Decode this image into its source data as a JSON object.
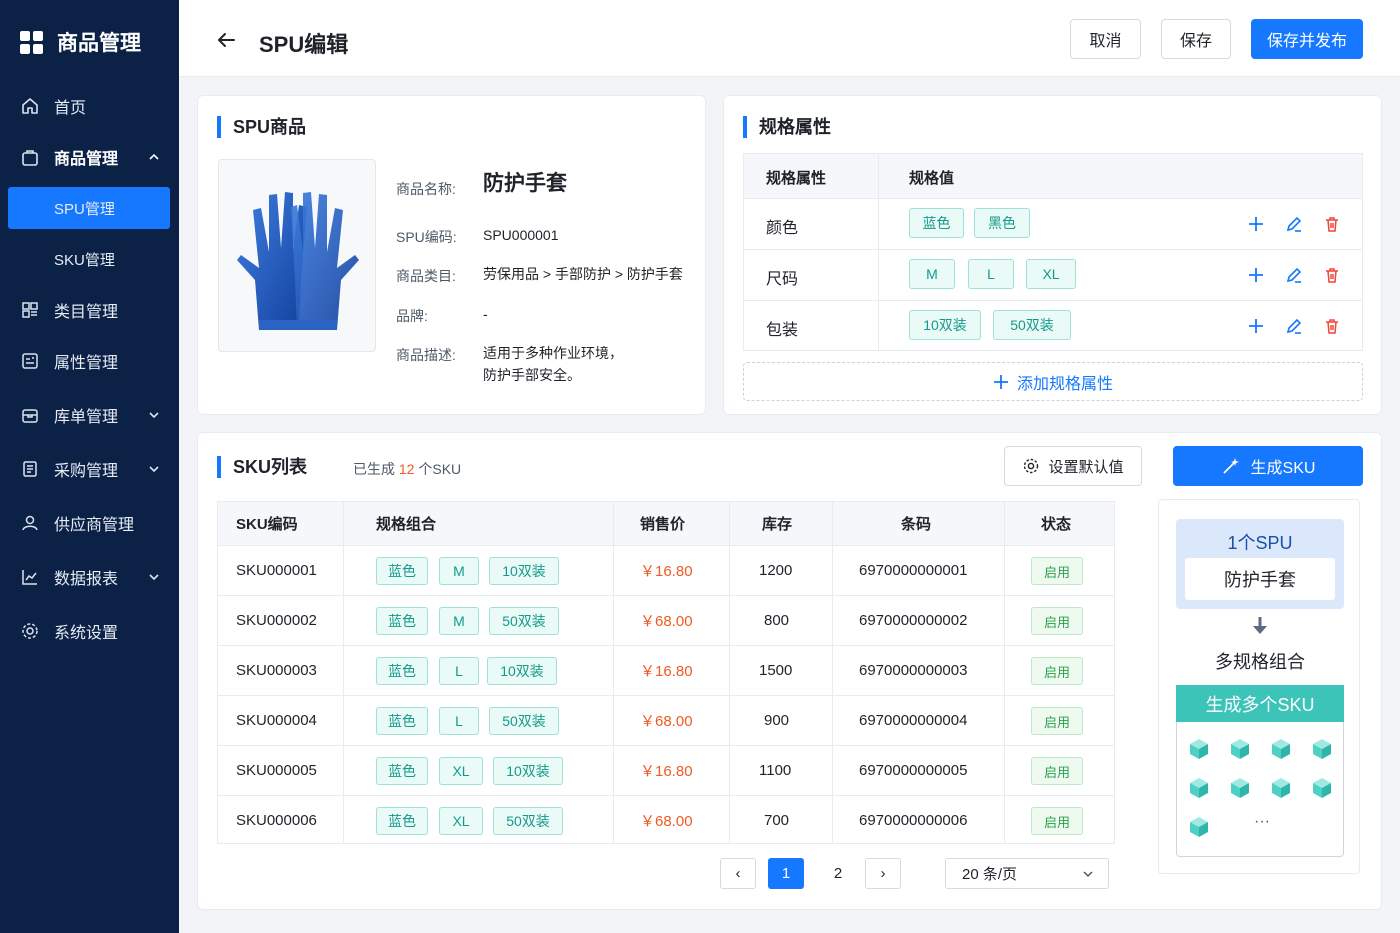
{
  "app": {
    "title": "商品管理"
  },
  "sidebar": {
    "items": [
      {
        "label": "首页",
        "icon": "home-icon"
      },
      {
        "label": "商品管理",
        "icon": "bag-icon"
      },
      {
        "label": "SPU管理"
      },
      {
        "label": "SKU管理"
      },
      {
        "label": "类目管理",
        "icon": "category-icon"
      },
      {
        "label": "属性管理",
        "icon": "attribute-icon"
      },
      {
        "label": "库单管理",
        "icon": "warehouse-icon"
      },
      {
        "label": "采购管理",
        "icon": "purchase-icon"
      },
      {
        "label": "供应商管理",
        "icon": "supplier-icon"
      },
      {
        "label": "数据报表",
        "icon": "chart-icon"
      },
      {
        "label": "系统设置",
        "icon": "settings-icon"
      }
    ]
  },
  "header": {
    "title": "SPU编辑",
    "cancel": "取消",
    "save": "保存",
    "save_publish": "保存并发布"
  },
  "spu": {
    "title": "SPU商品",
    "name_label": "商品名称:",
    "name": "防护手套",
    "code_label": "SPU编码:",
    "code": "SPU000001",
    "category_label": "商品类目:",
    "category": "劳保用品 > 手部防护 > 防护手套",
    "brand_label": "品牌:",
    "brand": "-",
    "desc_label": "商品描述:",
    "desc": "适用于多种作业环境，防护手部安全。"
  },
  "spec": {
    "title": "规格属性",
    "col_attr": "规格属性",
    "col_values": "规格值",
    "rows": [
      {
        "name": "颜色",
        "values": [
          "蓝色",
          "黑色"
        ]
      },
      {
        "name": "尺码",
        "values": [
          "M",
          "L",
          "XL"
        ]
      },
      {
        "name": "包装",
        "values": [
          "10双装",
          "50双装"
        ]
      }
    ],
    "add_label": "添加规格属性"
  },
  "sku": {
    "title": "SKU列表",
    "generated_prefix": "已生成",
    "generated_count": "12",
    "generated_suffix": "个SKU",
    "set_default": "设置默认值",
    "generate": "生成SKU",
    "columns": [
      "SKU编码",
      "规格组合",
      "销售价",
      "库存",
      "条码",
      "状态"
    ],
    "rows": [
      {
        "code": "SKU000001",
        "color": "蓝色",
        "size": "M",
        "pack": "10双装",
        "price": "￥16.80",
        "stock": "1200",
        "barcode": "6970000000001",
        "status": "启用"
      },
      {
        "code": "SKU000002",
        "color": "蓝色",
        "size": "M",
        "pack": "50双装",
        "price": "￥68.00",
        "stock": "800",
        "barcode": "6970000000002",
        "status": "启用"
      },
      {
        "code": "SKU000003",
        "color": "蓝色",
        "size": "L",
        "pack": "10双装",
        "price": "￥16.80",
        "stock": "1500",
        "barcode": "6970000000003",
        "status": "启用"
      },
      {
        "code": "SKU000004",
        "color": "蓝色",
        "size": "L",
        "pack": "50双装",
        "price": "￥68.00",
        "stock": "900",
        "barcode": "6970000000004",
        "status": "启用"
      },
      {
        "code": "SKU000005",
        "color": "蓝色",
        "size": "XL",
        "pack": "10双装",
        "price": "￥16.80",
        "stock": "1100",
        "barcode": "6970000000005",
        "status": "启用"
      },
      {
        "code": "SKU000006",
        "color": "蓝色",
        "size": "XL",
        "pack": "50双装",
        "price": "￥68.00",
        "stock": "700",
        "barcode": "6970000000006",
        "status": "启用"
      }
    ]
  },
  "pagination": {
    "prev": "‹",
    "next": "›",
    "pages": [
      "1",
      "2"
    ],
    "current": "1",
    "page_size": "20 条/页"
  },
  "illustration": {
    "spu_count": "1个SPU",
    "product": "防护手套",
    "combo": "多规格组合",
    "generate": "生成多个SKU",
    "more": "···"
  },
  "colors": {
    "primary": "#1677ff",
    "sidebar": "#0b2145",
    "tag": "#149a8c",
    "price": "#f05a23",
    "status": "#2ba14a",
    "danger": "#f04438"
  }
}
